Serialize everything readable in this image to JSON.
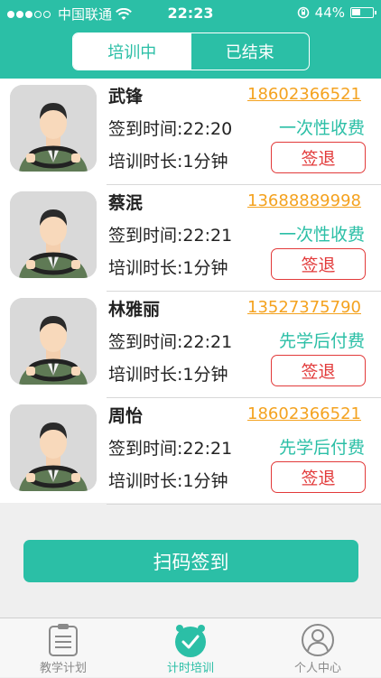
{
  "statusbar": {
    "carrier": "中国联通",
    "time": "22:23",
    "battery": "44%"
  },
  "segment": {
    "active_label": "培训中",
    "inactive_label": "已结束"
  },
  "students": [
    {
      "name": "武锋",
      "phone": "18602366521",
      "signin": "签到时间:22:20",
      "fee": "一次性收费",
      "duration": "培训时长:1分钟",
      "action": "签退"
    },
    {
      "name": "蔡泯",
      "phone": "13688889998",
      "signin": "签到时间:22:21",
      "fee": "一次性收费",
      "duration": "培训时长:1分钟",
      "action": "签退"
    },
    {
      "name": "林雅丽",
      "phone": "13527375790",
      "signin": "签到时间:22:21",
      "fee": "先学后付费",
      "duration": "培训时长:1分钟",
      "action": "签退"
    },
    {
      "name": "周怡",
      "phone": "18602366521",
      "signin": "签到时间:22:21",
      "fee": "先学后付费",
      "duration": "培训时长:1分钟",
      "action": "签退"
    }
  ],
  "scan_button": "扫码签到",
  "tabs": [
    {
      "label": "教学计划",
      "icon": "clipboard-icon"
    },
    {
      "label": "计时培训",
      "icon": "alarm-clock-icon"
    },
    {
      "label": "个人中心",
      "icon": "user-icon"
    }
  ],
  "colors": {
    "accent": "#2bbfa6",
    "phone": "#f4a21f",
    "danger": "#e23a3a"
  }
}
